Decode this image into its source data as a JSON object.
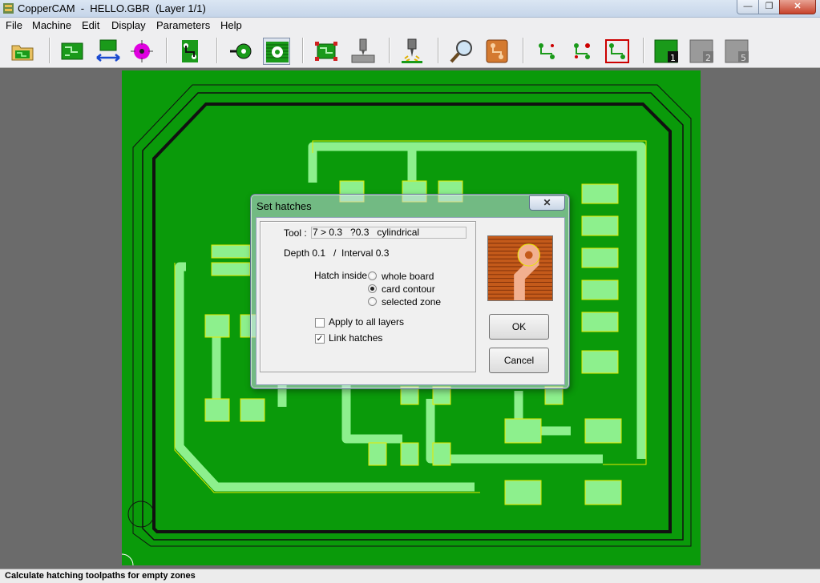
{
  "window": {
    "title": "CopperCAM  -  HELLO.GBR  (Layer 1/1)",
    "minimize_glyph": "—",
    "maximize_glyph": "❐",
    "close_glyph": "✕"
  },
  "menu": {
    "items": [
      "File",
      "Machine",
      "Edit",
      "Display",
      "Parameters",
      "Help"
    ]
  },
  "toolbar": {
    "buttons": [
      "open-board-icon",
      "board-view-icon",
      "mirror-board-icon",
      "drill-point-icon",
      "trace-icon",
      "pad-contour-icon",
      "hatch-icon",
      "frame-icon",
      "engrave-icon",
      "drill-machine-icon",
      "zoom-icon",
      "pcb-view-icon",
      "net-1-icon",
      "net-2-icon",
      "net-3-icon",
      "layer-1-icon",
      "layer-2-icon",
      "layer-5-icon"
    ],
    "layer_labels": [
      "1",
      "2",
      "5"
    ]
  },
  "colors": {
    "board_green": "#0a9a0a",
    "track_light": "#8df08d",
    "outline_yellow": "#e8e800",
    "accent_magenta": "#e000e0",
    "copper": "#c45a1a"
  },
  "dialog": {
    "title": "Set hatches",
    "close_glyph": "✕",
    "tool_label": "Tool :",
    "tool_value": "7 > 0.3   ?0.3   cylindrical",
    "depth_text": "Depth 0.1   /  Interval 0.3",
    "hatch_inside_label": "Hatch inside",
    "hatch_options": [
      {
        "label": "whole board",
        "selected": false
      },
      {
        "label": "card contour",
        "selected": true
      },
      {
        "label": "selected zone",
        "selected": false
      }
    ],
    "apply_all_label": "Apply to all layers",
    "apply_all_checked": false,
    "link_hatches_label": "Link hatches",
    "link_hatches_checked": true,
    "ok_label": "OK",
    "cancel_label": "Cancel"
  },
  "status": {
    "text": "Calculate hatching toolpaths for empty zones"
  }
}
